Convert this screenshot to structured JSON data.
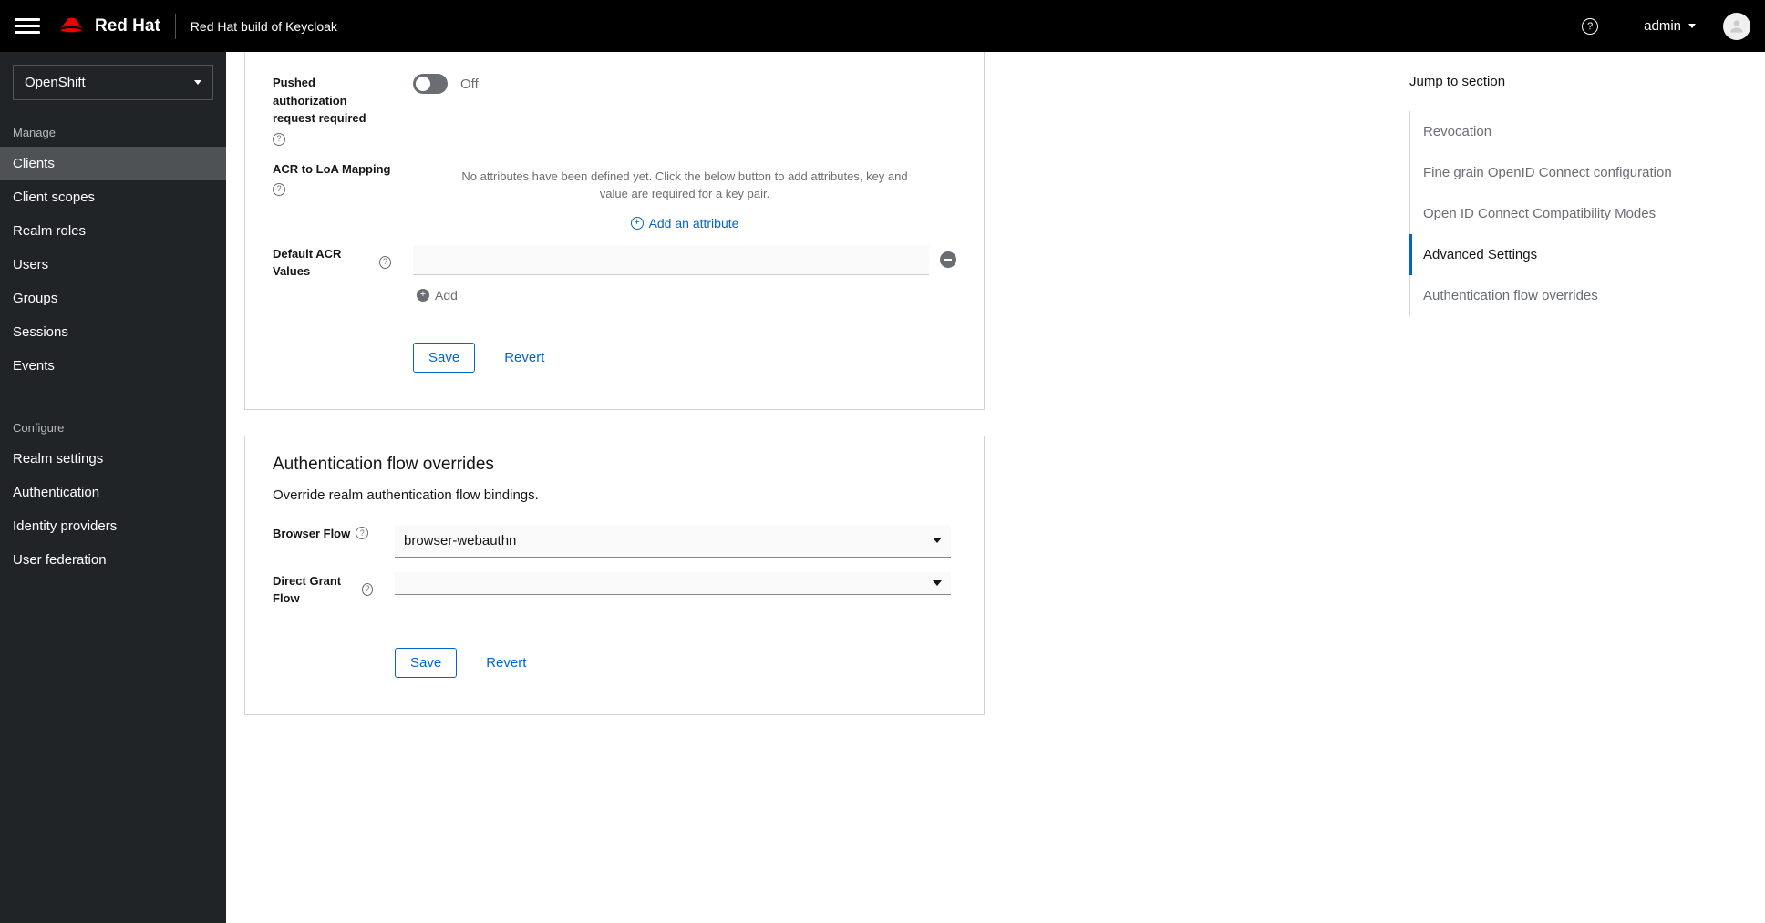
{
  "header": {
    "brand": "Red Hat",
    "product": "Red Hat build of Keycloak",
    "help": "?",
    "user": "admin"
  },
  "sidebar": {
    "realm": "OpenShift",
    "sections": {
      "manage": {
        "label": "Manage",
        "items": [
          "Clients",
          "Client scopes",
          "Realm roles",
          "Users",
          "Groups",
          "Sessions",
          "Events"
        ]
      },
      "configure": {
        "label": "Configure",
        "items": [
          "Realm settings",
          "Authentication",
          "Identity providers",
          "User federation"
        ]
      }
    }
  },
  "advanced": {
    "pushed_auth_label": "Pushed authorization request required",
    "off_label": "Off",
    "acr_loa_label": "ACR to LoA Mapping",
    "empty_attr_text": "No attributes have been defined yet. Click the below button to add attributes, key and value are required for a key pair.",
    "add_attribute_label": "Add an attribute",
    "default_acr_label": "Default ACR Values",
    "add_label": "Add",
    "save_label": "Save",
    "revert_label": "Revert"
  },
  "auth_flow": {
    "title": "Authentication flow overrides",
    "desc": "Override realm authentication flow bindings.",
    "browser_label": "Browser Flow",
    "browser_value": "browser-webauthn",
    "direct_label": "Direct Grant Flow",
    "direct_value": "",
    "save_label": "Save",
    "revert_label": "Revert"
  },
  "jump": {
    "title": "Jump to section",
    "items": [
      {
        "label": "Revocation",
        "active": false
      },
      {
        "label": "Fine grain OpenID Connect configuration",
        "active": false
      },
      {
        "label": "Open ID Connect Compatibility Modes",
        "active": false
      },
      {
        "label": "Advanced Settings",
        "active": true
      },
      {
        "label": "Authentication flow overrides",
        "active": false
      }
    ]
  }
}
